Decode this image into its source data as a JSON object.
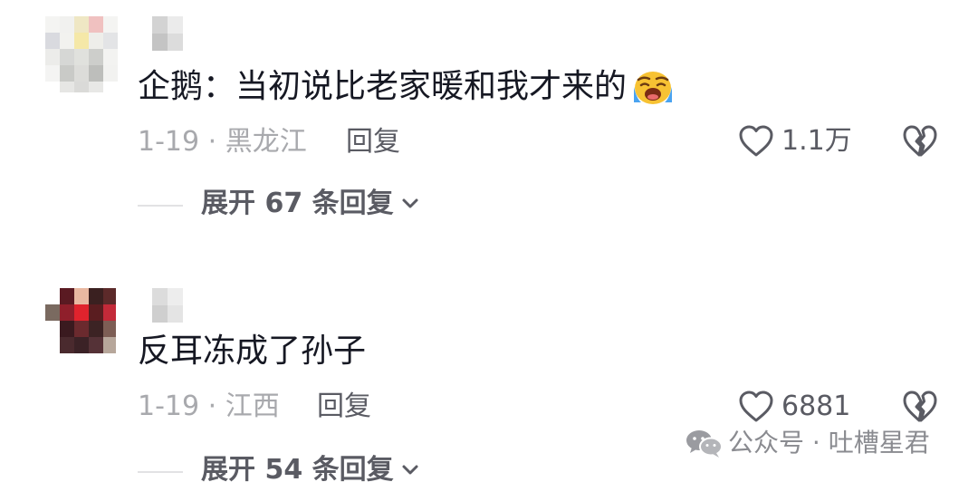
{
  "comments": [
    {
      "text": "企鹅：当初说比老家暖和我才来的",
      "emoji": "loudly-crying-face-emoji",
      "date_location": "1-19 · 黑龙江",
      "reply_label": "回复",
      "likes": "1.1万",
      "expand_label": "展开 67 条回复"
    },
    {
      "text": "反耳冻成了孙子",
      "date_location": "1-19 · 江西",
      "reply_label": "回复",
      "likes": "6881",
      "expand_label": "展开 54 条回复"
    }
  ],
  "watermark": {
    "text": "公众号 · 吐槽星君",
    "icon": "wechat-icon"
  },
  "colors": {
    "primary_text": "#161823",
    "secondary_text": "#a8a9ad",
    "action_text": "#5a5b63",
    "divider": "#e2e2e4",
    "emoji_face": "#f7c233",
    "emoji_tears": "#4aa3f0"
  }
}
